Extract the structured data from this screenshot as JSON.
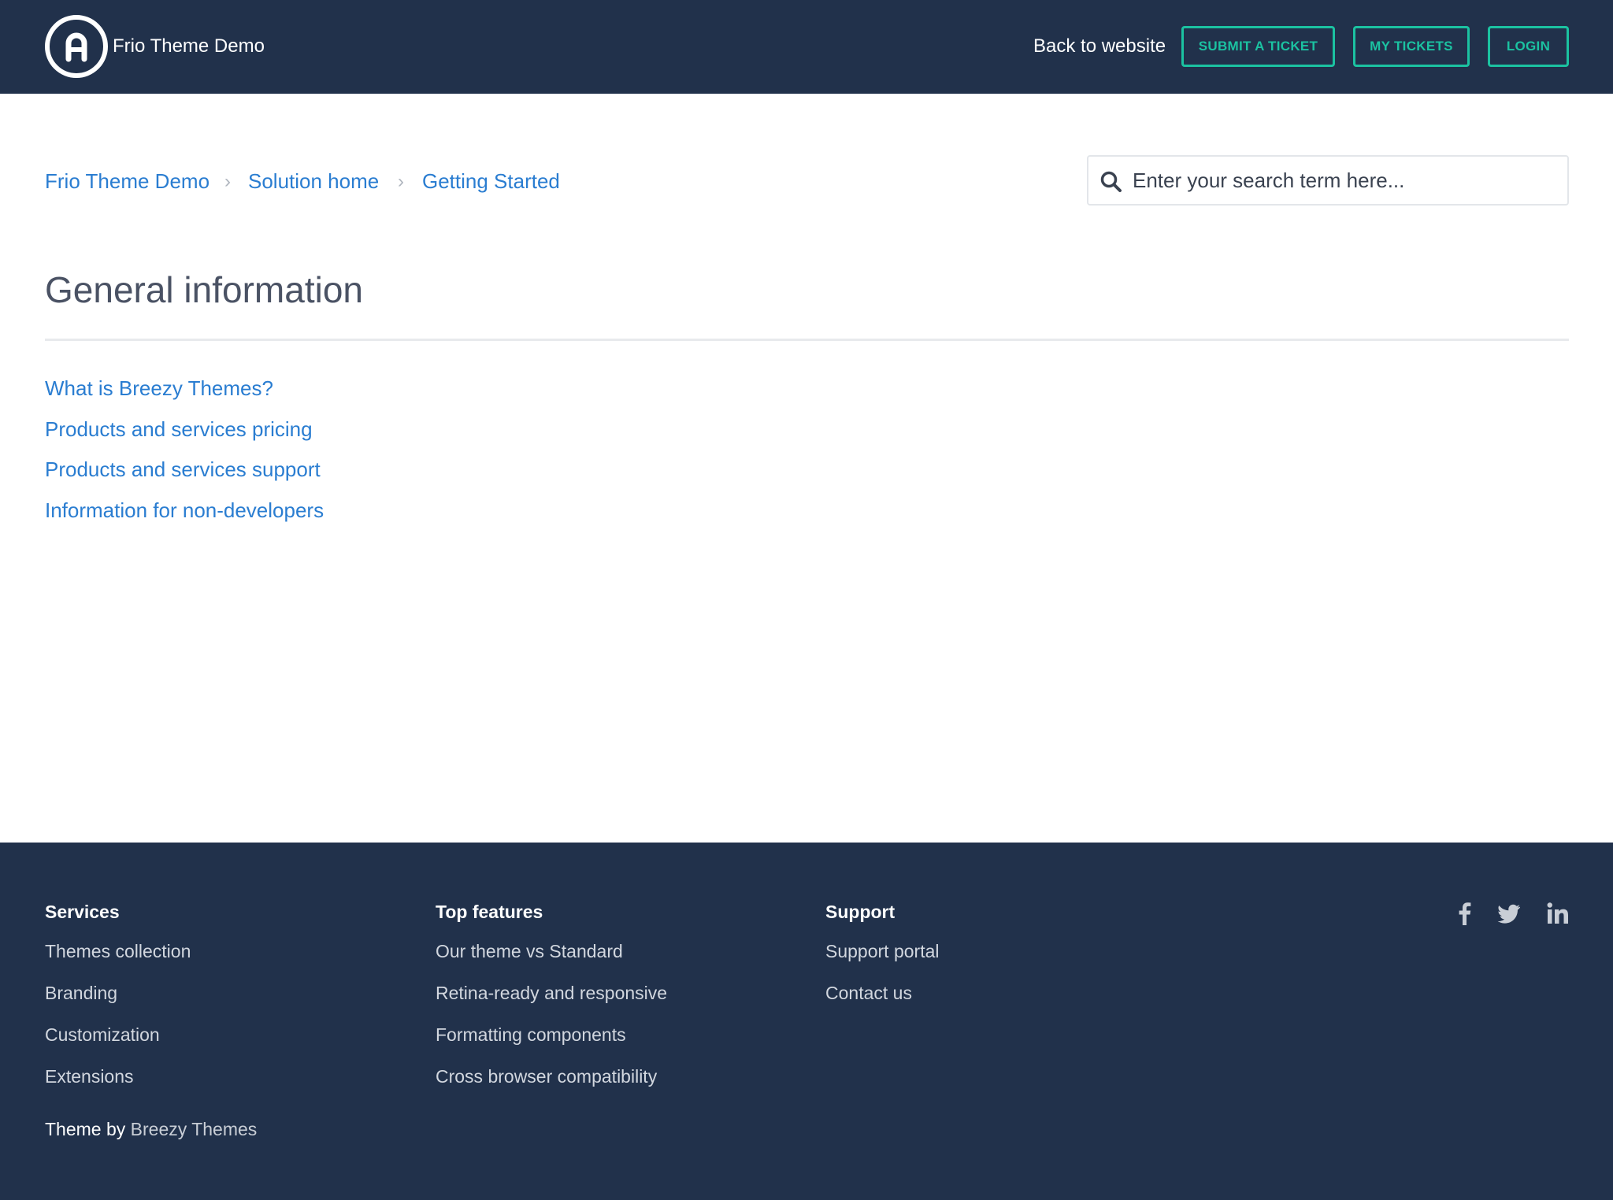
{
  "header": {
    "brand_name": "Frio Theme Demo",
    "back_to_website": "Back to website",
    "submit_ticket": "SUBMIT A TICKET",
    "my_tickets": "MY TICKETS",
    "login": "LOGIN"
  },
  "breadcrumb": {
    "items": [
      "Frio Theme Demo",
      "Solution home",
      "Getting Started"
    ],
    "separator": "›"
  },
  "search": {
    "placeholder": "Enter your search term here..."
  },
  "main": {
    "title": "General information",
    "articles": [
      "What is Breezy Themes?",
      "Products and services pricing",
      "Products and services support",
      "Information for non-developers"
    ]
  },
  "footer": {
    "columns": [
      {
        "title": "Services",
        "links": [
          "Themes collection",
          "Branding",
          "Customization",
          "Extensions"
        ]
      },
      {
        "title": "Top features",
        "links": [
          "Our theme vs Standard",
          "Retina-ready and responsive",
          "Formatting components",
          "Cross browser compatibility"
        ]
      },
      {
        "title": "Support",
        "links": [
          "Support portal",
          "Contact us"
        ]
      }
    ],
    "credit_prefix": "Theme by",
    "credit_link": "Breezy Themes",
    "social_icons": [
      "facebook-icon",
      "twitter-icon",
      "linkedin-icon"
    ]
  },
  "colors": {
    "header_bg": "#21314b",
    "accent": "#1bc2a1",
    "link": "#2a7dd1",
    "footer_bg": "#21314b"
  }
}
